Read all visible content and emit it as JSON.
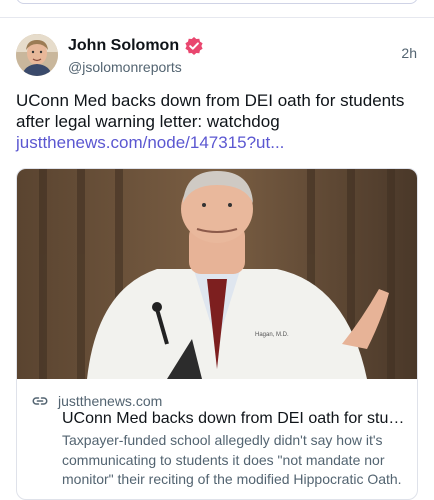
{
  "post": {
    "author": {
      "display_name": "John Solomon",
      "handle": "@jsolomonreports",
      "avatar_icon": "avatar-photo",
      "verified_icon": "verified-badge-icon"
    },
    "time": "2h",
    "text": "UConn Med backs down from DEI oath for students after legal warning letter: watchdog ",
    "link": "justthenews.com/node/147315?ut..."
  },
  "embed": {
    "image_icon": "article-photo-speaker",
    "link_icon": "link-icon",
    "domain": "justthenews.com",
    "title": "UConn Med backs down from DEI oath for stud...",
    "description": "Taxpayer-funded school allegedly didn't say how it's communicating to students it does \"not mandate nor monitor\" their reciting of the modified Hippocratic Oath."
  },
  "colors": {
    "link": "#5b57d1",
    "verified": "#e9476f",
    "secondary_text": "#536471",
    "border": "#dfe2ea"
  }
}
